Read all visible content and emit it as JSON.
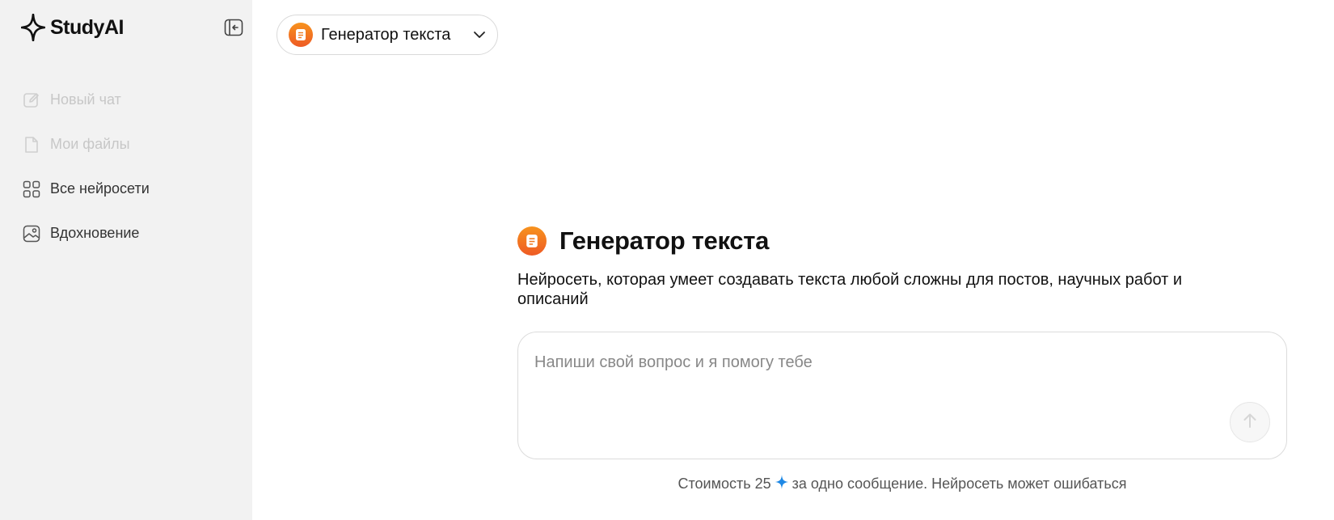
{
  "brand": {
    "name": "StudyAI",
    "icon": "sparkle-star-icon"
  },
  "sidebar": {
    "collapse_icon": "sidebar-collapse-icon",
    "items": [
      {
        "label": "Новый чат",
        "icon": "edit-icon",
        "disabled": true
      },
      {
        "label": "Мои файлы",
        "icon": "file-icon",
        "disabled": true
      },
      {
        "label": "Все нейросети",
        "icon": "grid-icon",
        "disabled": false
      },
      {
        "label": "Вдохновение",
        "icon": "image-icon",
        "disabled": false
      }
    ]
  },
  "model_selector": {
    "label": "Генератор текста",
    "icon": "document-icon"
  },
  "hero": {
    "title": "Генератор текста",
    "description": "Нейросеть, которая умеет создавать текста любой сложны для постов, научных работ и описаний"
  },
  "composer": {
    "placeholder": "Напиши свой вопрос и я помогу тебе",
    "value": "",
    "send_icon": "arrow-up-icon"
  },
  "footnote": {
    "prefix": "Стоимость 25",
    "suffix": "за одно сообщение. Нейросеть может ошибаться",
    "icon": "sparkle-icon"
  },
  "colors": {
    "sidebar_bg": "#f2f2f2",
    "accent_orange": "#f7931e",
    "spark_blue": "#1e88e5"
  }
}
